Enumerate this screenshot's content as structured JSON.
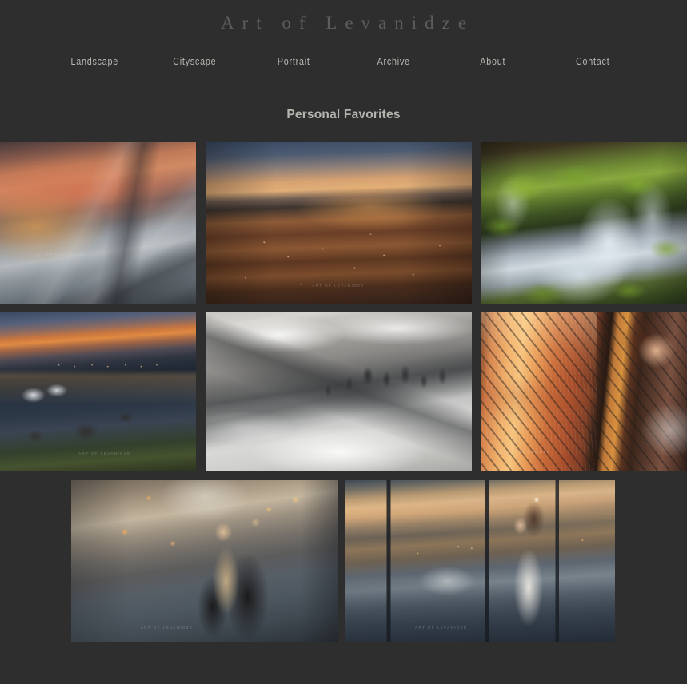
{
  "site": {
    "title": "Art of Levanidze",
    "background_color": "#2e2e2e",
    "text_color": "#b9b7b2"
  },
  "nav": {
    "items": [
      {
        "label": "Landscape"
      },
      {
        "label": "Cityscape"
      },
      {
        "label": "Portrait"
      },
      {
        "label": "Archive"
      },
      {
        "label": "About"
      },
      {
        "label": "Contact"
      }
    ]
  },
  "section": {
    "heading": "Personal Favorites"
  },
  "gallery": {
    "watermark": "Art of Levanidze",
    "rows": [
      {
        "tiles": [
          {
            "name": "alpine-sunset-ridge",
            "alt": "Snow covered mountain ridge glowing orange under sunset clouds"
          },
          {
            "name": "old-town-fortress-dusk",
            "alt": "Hilltop fortress above an illuminated old town at dusk"
          },
          {
            "name": "mossy-waterfall",
            "alt": "Silky waterfall cascading over bright green mossy boulders"
          }
        ]
      },
      {
        "tiles": [
          {
            "name": "swans-waterfront-dusk",
            "alt": "Swans on calm water before a lit waterfront skyline at dusk"
          },
          {
            "name": "foggy-forest-ridge",
            "alt": "Pine covered ridge emerging from a sea of fog"
          },
          {
            "name": "rainy-window-portrait",
            "alt": "Woman looking out a rain streaked window at an orange sunset over water"
          }
        ]
      },
      {
        "tiles": [
          {
            "name": "street-bokeh-portrait",
            "alt": "Portrait of a woman on a city street with warm bokeh lights"
          },
          {
            "name": "rooftop-terrace-portrait",
            "alt": "Woman in white on a rooftop terrace overlooking a city at sunset"
          }
        ]
      }
    ]
  }
}
